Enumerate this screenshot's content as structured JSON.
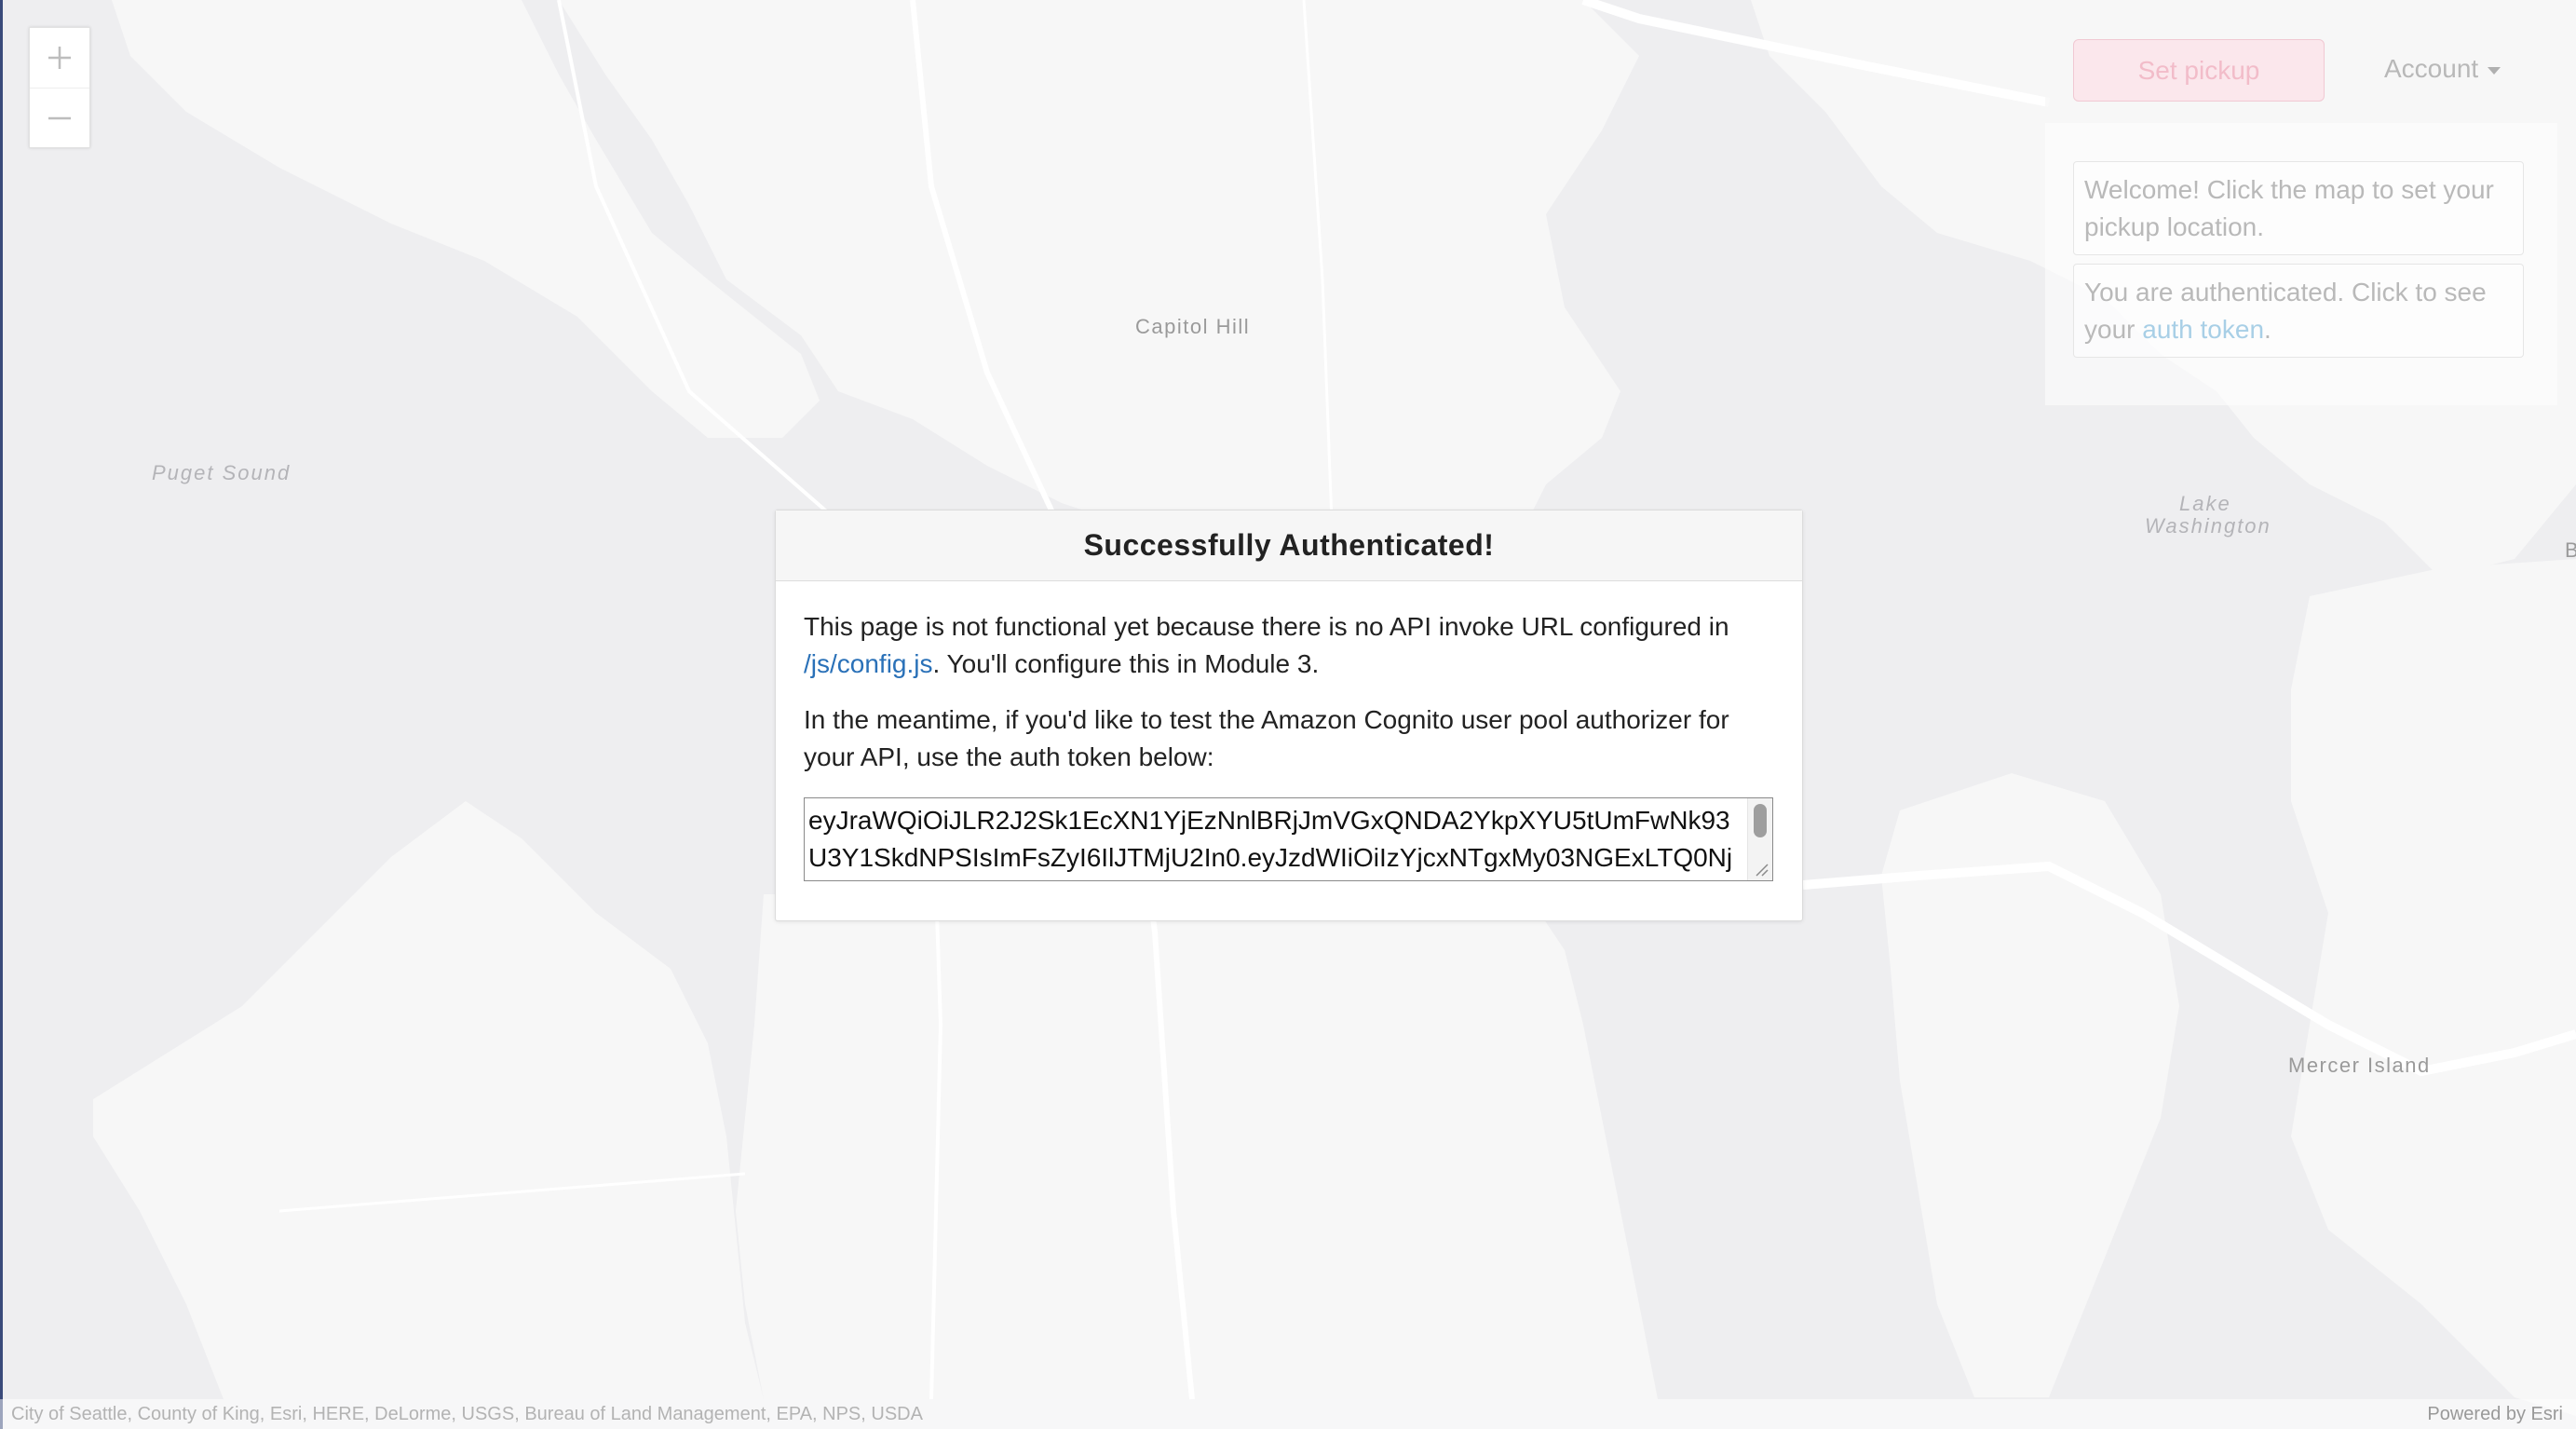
{
  "map": {
    "labels": {
      "capitol_hill": "Capitol Hill",
      "puget_sound": "Puget Sound",
      "lake": "Lake",
      "washington": "Washington",
      "mercer_island": "Mercer Island",
      "edge_letter": "B"
    },
    "colors": {
      "water": "#eeeef0",
      "land": "#f7f7f7",
      "road": "#ffffff"
    }
  },
  "zoom": {
    "in_icon": "plus-icon",
    "out_icon": "minus-icon"
  },
  "header": {
    "set_pickup_label": "Set pickup",
    "account_label": "Account"
  },
  "messages": {
    "welcome": "Welcome! Click the map to set your pickup location.",
    "auth_prefix": "You are authenticated. Click to see your ",
    "auth_link": "auth token",
    "auth_suffix": "."
  },
  "modal": {
    "title": "Successfully Authenticated!",
    "p1_text": "This page is not functional yet because there is no API invoke URL configured in ",
    "p1_link": "/js/config.js",
    "p1_suffix": ". You'll configure this in Module 3.",
    "p2_text": "In the meantime, if you'd like to test the Amazon Cognito user pool authorizer for your API, use the auth token below:",
    "token_line1": "eyJraWQiOiJLR2J2Sk1EcXN1YjEzNnlBRjJmVGxQNDA2YkpXYU5tUmFwNk93",
    "token_line2": "U3Y1SkdNPSIsImFsZyI6IlJTMjU2In0.eyJzdWIiOiIzYjcxNTgxMy03NGExLTQ0Nj"
  },
  "attribution": {
    "sources": "City of Seattle, County of King, Esri, HERE, DeLorme, USGS, Bureau of Land Management, EPA, NPS, USDA",
    "powered_by": "Powered by Esri"
  }
}
